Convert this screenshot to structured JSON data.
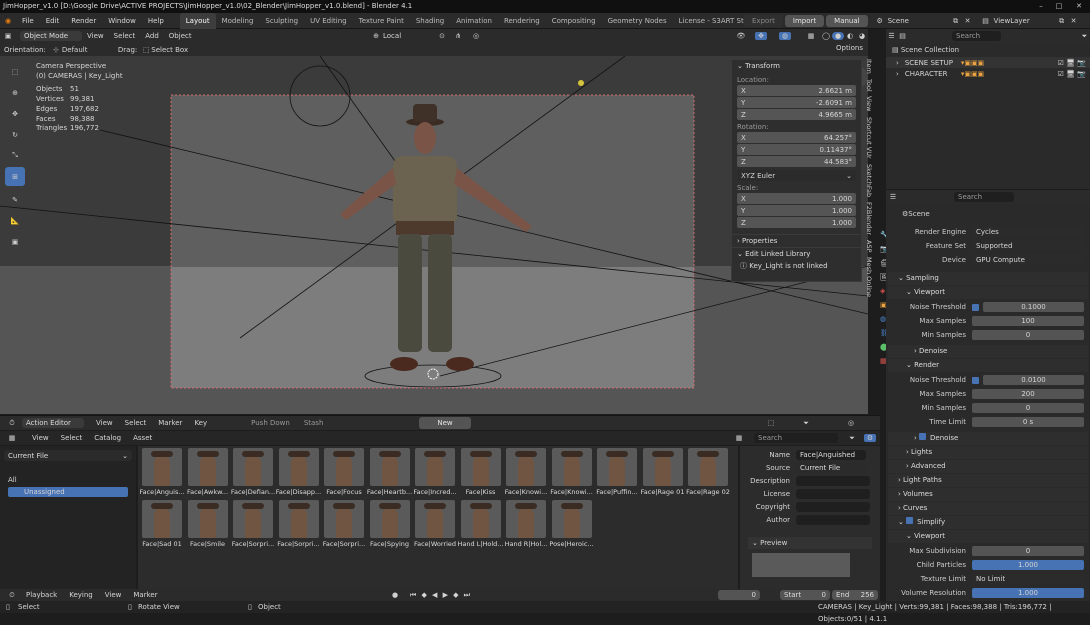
{
  "window": {
    "title": "JimHopper_v1.0 [D:\\Google Drive\\ACTIVE PROJECTS\\JimHopper_v1.0\\02_Blender\\JimHopper_v1.0.blend] - Blender 4.1"
  },
  "menu": [
    "File",
    "Edit",
    "Render",
    "Window",
    "Help"
  ],
  "workspaces": [
    "Layout",
    "Modeling",
    "Sculpting",
    "UV Editing",
    "Texture Paint",
    "Shading",
    "Animation",
    "Rendering",
    "Compositing",
    "Geometry Nodes",
    "License - S3ART Store"
  ],
  "top_right": {
    "export": "Export",
    "import": "Import",
    "manual": "Manual",
    "scene": "Scene",
    "view_layer": "ViewLayer"
  },
  "viewport_header": {
    "mode": "Object Mode",
    "menus": [
      "View",
      "Select",
      "Add",
      "Object"
    ],
    "transform_orientation": "Local",
    "options": "Options"
  },
  "viewport_header2": {
    "orientation_label": "Orientation:",
    "orientation": "Default",
    "drag_label": "Drag:",
    "drag": "Select Box"
  },
  "overlay_stats": {
    "title1": "Camera Perspective",
    "title2": "(0) CAMERAS | Key_Light",
    "rows": [
      {
        "k": "Objects",
        "v": "51"
      },
      {
        "k": "Vertices",
        "v": "99,381"
      },
      {
        "k": "Edges",
        "v": "197,682"
      },
      {
        "k": "Faces",
        "v": "98,388"
      },
      {
        "k": "Triangles",
        "v": "196,772"
      }
    ]
  },
  "npanel": {
    "transform": "Transform",
    "location": "Location:",
    "loc": [
      {
        "k": "X",
        "v": "2.6621 m"
      },
      {
        "k": "Y",
        "v": "-2.6091 m"
      },
      {
        "k": "Z",
        "v": "4.9665 m"
      }
    ],
    "rotation": "Rotation:",
    "rot": [
      {
        "k": "X",
        "v": "64.257°"
      },
      {
        "k": "Y",
        "v": "0.11437°"
      },
      {
        "k": "Z",
        "v": "44.583°"
      }
    ],
    "euler": "XYZ Euler",
    "scale": "Scale:",
    "scl": [
      {
        "k": "X",
        "v": "1.000"
      },
      {
        "k": "Y",
        "v": "1.000"
      },
      {
        "k": "Z",
        "v": "1.000"
      }
    ],
    "properties": "Properties",
    "linked_lib": "Edit Linked Library",
    "not_linked": "Key_Light is not linked"
  },
  "side_tabs": [
    "Item",
    "Tool",
    "View",
    "Shortcut VUr",
    "SketchFab",
    "F2Blender",
    "ASP",
    "Mesh Online"
  ],
  "outliner": {
    "search": "Search",
    "root": "Scene Collection",
    "items": [
      "SCENE SETUP",
      "CHARACTER"
    ]
  },
  "properties": {
    "search": "Search",
    "scene": "Scene",
    "render_engine": {
      "k": "Render Engine",
      "v": "Cycles"
    },
    "feature_set": {
      "k": "Feature Set",
      "v": "Supported"
    },
    "device": {
      "k": "Device",
      "v": "GPU Compute"
    },
    "sampling": "Sampling",
    "viewport": "Viewport",
    "vp_noise": {
      "k": "Noise Threshold",
      "v": "0.1000"
    },
    "vp_max": {
      "k": "Max Samples",
      "v": "100"
    },
    "vp_min": {
      "k": "Min Samples",
      "v": "0"
    },
    "denoise": "Denoise",
    "render": "Render",
    "r_noise": {
      "k": "Noise Threshold",
      "v": "0.0100"
    },
    "r_max": {
      "k": "Max Samples",
      "v": "200"
    },
    "r_min": {
      "k": "Min Samples",
      "v": "0"
    },
    "r_time": {
      "k": "Time Limit",
      "v": "0 s"
    },
    "denoise2": "Denoise",
    "lights": "Lights",
    "advanced": "Advanced",
    "light_paths": "Light Paths",
    "volumes": "Volumes",
    "curves": "Curves",
    "simplify": "Simplify",
    "viewport2": "Viewport",
    "max_subdiv": {
      "k": "Max Subdivision",
      "v": "0"
    },
    "child_particles": {
      "k": "Child Particles",
      "v": "1.000"
    },
    "texture_limit": {
      "k": "Texture Limit",
      "v": "No Limit"
    },
    "volume_resolution": {
      "k": "Volume Resolution",
      "v": "1.000"
    }
  },
  "action_editor": {
    "mode": "Action Editor",
    "menus": [
      "View",
      "Select",
      "Marker",
      "Key"
    ],
    "push_down": "Push Down",
    "stash": "Stash",
    "new": "New"
  },
  "asset_browser": {
    "menus": [
      "View",
      "Select",
      "Catalog",
      "Asset"
    ],
    "library": "Current File",
    "search": "Search",
    "catalogs": [
      "All",
      "Unassigned"
    ],
    "assets": [
      "Face|Anguis...",
      "Face|Awkw...",
      "Face|Defian...",
      "Face|Disapp...",
      "Face|Focus",
      "Face|Heartb...",
      "Face|Incred...",
      "Face|Kiss",
      "Face|Knowi...",
      "Face|Knowi...",
      "Face|Puffin...",
      "Face|Rage 01",
      "Face|Rage 02",
      "Face|Sad 01",
      "Face|Smile",
      "Face|Sorpri...",
      "Face|Sorpri...",
      "Face|Sorpri...",
      "Face|Spying",
      "Face|Worried",
      "Hand L|Hold...",
      "Hand R|Hol...",
      "Pose|Heroic..."
    ],
    "meta": {
      "name_k": "Name",
      "name_v": "Face|Anguished",
      "source_k": "Source",
      "source_v": "Current File",
      "description": "Description",
      "license": "License",
      "copyright": "Copyright",
      "author": "Author",
      "preview": "Preview"
    }
  },
  "timeline": {
    "menus": [
      "Playback",
      "Keying",
      "View",
      "Marker"
    ],
    "frame": "0",
    "start_label": "Start",
    "start": "0",
    "end_label": "End",
    "end": "256"
  },
  "statusbar": {
    "select": "Select",
    "rotate": "Rotate View",
    "object": "Object",
    "info": "CAMERAS | Key_Light | Verts:99,381 | Faces:98,388 | Tris:196,772 | Objects:0/51 | 4.1.1"
  }
}
